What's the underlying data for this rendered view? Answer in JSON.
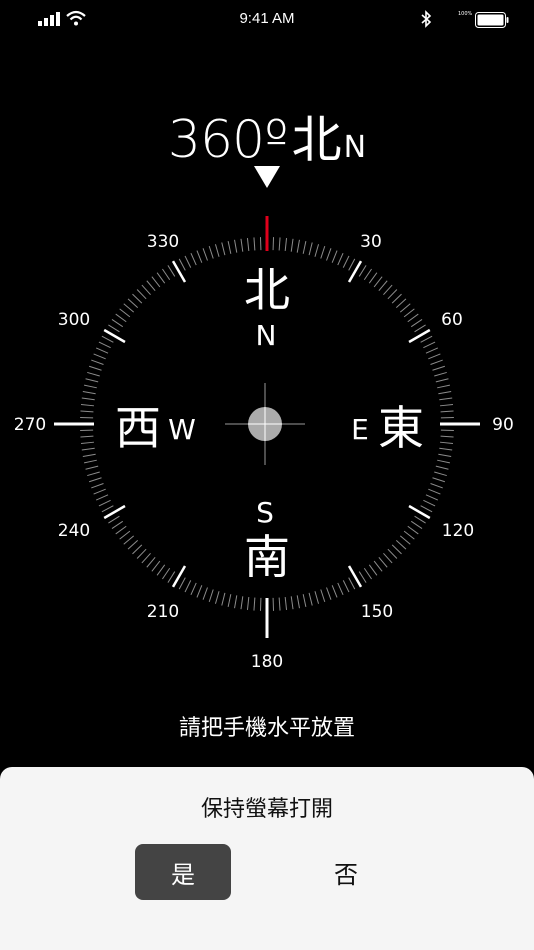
{
  "status_bar": {
    "time": "9:41 AM",
    "battery_percent": "100%"
  },
  "heading": {
    "degrees": "360º",
    "direction_hanzi": "北",
    "direction_letter": "N"
  },
  "dial": {
    "ticks": [
      "30",
      "60",
      "90",
      "120",
      "150",
      "180",
      "210",
      "240",
      "270",
      "300",
      "330"
    ],
    "cardinals": {
      "north_hanzi": "北",
      "north_letter": "N",
      "east_hanzi": "東",
      "east_letter": "E",
      "south_hanzi": "南",
      "south_letter": "S",
      "west_hanzi": "西",
      "west_letter": "W"
    },
    "north_marker_color": "#e0001b"
  },
  "instruction": "請把手機水平放置",
  "dialog": {
    "title": "保持螢幕打開",
    "yes_label": "是",
    "no_label": "否"
  }
}
